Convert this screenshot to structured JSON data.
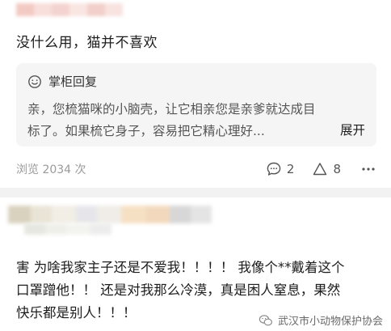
{
  "review": {
    "text": "没什么用，猫并不喜欢"
  },
  "reply": {
    "header": "掌柜回复",
    "line1": "亲，您梳猫咪的小脑壳，让它相亲您是亲爹就达成目",
    "line2": "标了。如果梳它身子，容易把它精心理好...",
    "expand_label": "展开"
  },
  "meta": {
    "views": "浏览 2034 次",
    "comments": "2",
    "shares": "8"
  },
  "comment2": {
    "line1": "害 为啥我家主子还是不爱我！！！！ 我像个**戴着这个",
    "line2": "口罩蹭他！！ 还是对我那么冷漠，真是困人窒息，果然",
    "line3": "快乐都是别人！！！"
  },
  "watermark": {
    "text": "武汉市小动物保护协会"
  },
  "colors": {
    "reply_bg": "#f5f5f6",
    "divider": "#f2f2f2",
    "muted": "#9a9a9a"
  },
  "icons": {
    "reply": "smile-icon",
    "comment": "comment-icon",
    "share": "triangle-share-icon",
    "more": "more-dots-icon"
  }
}
